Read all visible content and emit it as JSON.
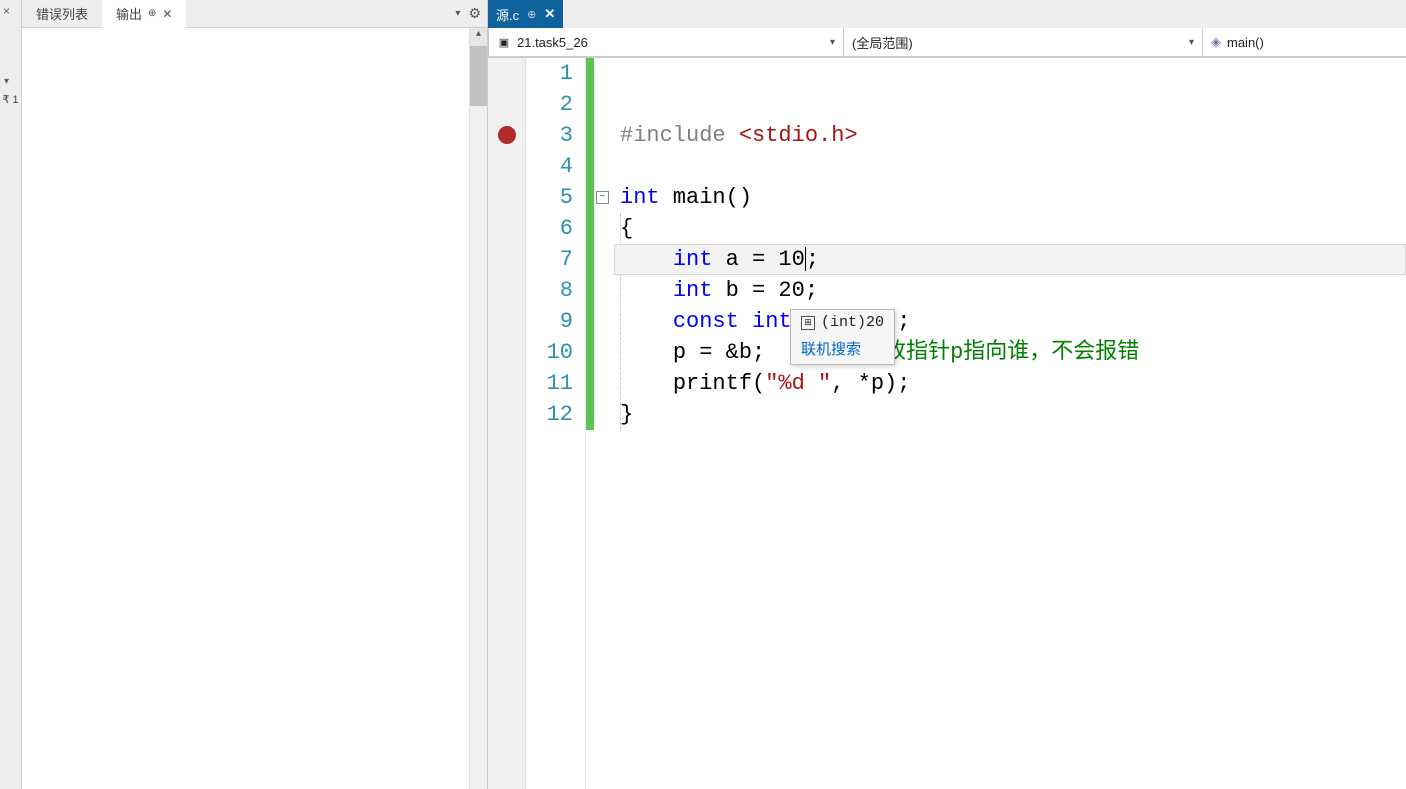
{
  "leftSidebar": {
    "closeGlyph": "×",
    "chevron": "▾",
    "badge": "₹ 1"
  },
  "leftPanel": {
    "tabs": [
      {
        "label": "错误列表",
        "active": false
      },
      {
        "label": "输出",
        "active": true,
        "pinned": true
      }
    ],
    "dropdownGlyph": "▾",
    "gearGlyph": "⚙"
  },
  "editor": {
    "tab": {
      "label": "源.c",
      "pinGlyph": "⊕",
      "closeGlyph": "✕"
    },
    "navCombos": [
      {
        "icon": "▣",
        "label": "21.task5_26"
      },
      {
        "icon": "",
        "label": "(全局范围)"
      },
      {
        "icon": "◈",
        "label": "main()"
      }
    ],
    "breakpointLine": 3,
    "lineNumbers": [
      "1",
      "2",
      "3",
      "4",
      "5",
      "6",
      "7",
      "8",
      "9",
      "10",
      "11",
      "12"
    ],
    "code": {
      "l3_include": "#include ",
      "l3_hdr": "<stdio.h>",
      "l5_int": "int",
      "l5_main": " main",
      "l5_paren": "()",
      "l6": "{",
      "l7_int": "int",
      "l7_rest": " a = 10",
      "l7_semi": ";",
      "l8_int": "int",
      "l8_rest": " b = 20;",
      "l9_const": "const",
      "l9_int": " int",
      "l9_tail": ";",
      "l10_code": "p = &b;",
      "l10_comment": "改指针p指向谁，不会报错",
      "l11_printf": "printf",
      "l11_open": "(",
      "l11_str": "\"%d \"",
      "l11_rest": ", *p);",
      "l12": "}"
    },
    "tooltip": {
      "typeInfo": "(int)20",
      "searchLink": "联机搜索"
    }
  }
}
